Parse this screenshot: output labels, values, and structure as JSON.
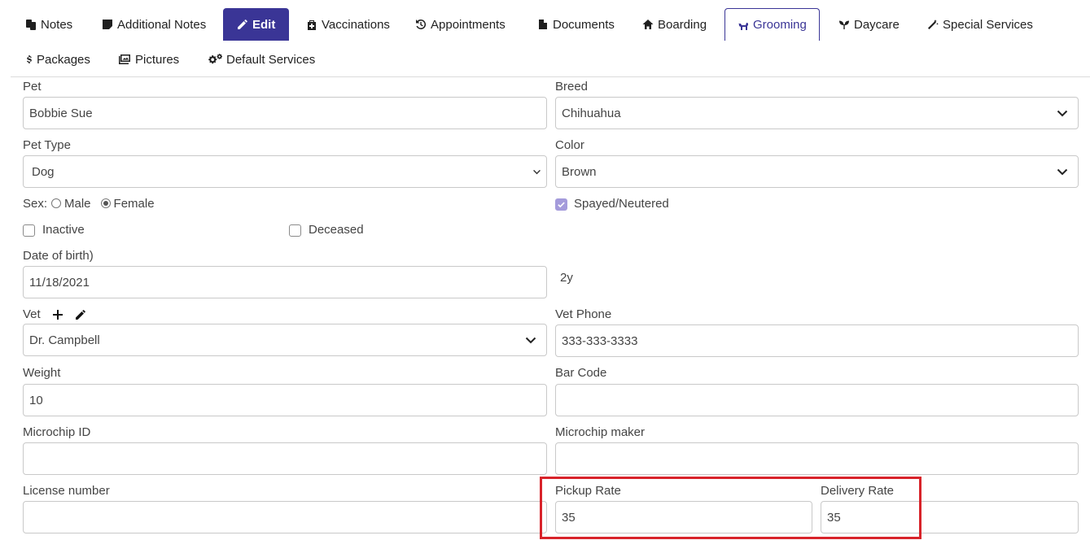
{
  "tabs": {
    "row1": [
      {
        "label": "Notes",
        "icon": "notes-icon"
      },
      {
        "label": "Additional Notes",
        "icon": "sticky-note-icon"
      },
      {
        "label": "Edit",
        "icon": "pencil-icon"
      },
      {
        "label": "Vaccinations",
        "icon": "medical-kit-icon"
      },
      {
        "label": "Appointments",
        "icon": "history-icon"
      },
      {
        "label": "Documents",
        "icon": "file-icon"
      },
      {
        "label": "Boarding",
        "icon": "home-icon"
      },
      {
        "label": "Grooming",
        "icon": "dog-icon"
      },
      {
        "label": "Daycare",
        "icon": "seedling-icon"
      },
      {
        "label": "Special Services",
        "icon": "magic-wand-icon"
      }
    ],
    "row2": [
      {
        "label": "Packages",
        "icon": "dollar-icon"
      },
      {
        "label": "Pictures",
        "icon": "images-icon"
      },
      {
        "label": "Default Services",
        "icon": "gears-icon"
      }
    ]
  },
  "form": {
    "pet": {
      "label": "Pet",
      "value": "Bobbie Sue"
    },
    "breed": {
      "label": "Breed",
      "value": "Chihuahua"
    },
    "pet_type": {
      "label": "Pet Type",
      "value": "Dog"
    },
    "color": {
      "label": "Color",
      "value": "Brown"
    },
    "sex": {
      "label": "Sex:",
      "options": [
        "Male",
        "Female"
      ],
      "selected": "Female"
    },
    "spayed": {
      "label": "Spayed/Neutered",
      "checked": true
    },
    "inactive": {
      "label": "Inactive",
      "checked": false
    },
    "deceased": {
      "label": "Deceased",
      "checked": false
    },
    "dob": {
      "label": "Date of birth)",
      "value": "11/18/2021",
      "age": "2y"
    },
    "vet": {
      "label": "Vet",
      "value": "Dr. Campbell"
    },
    "vet_phone": {
      "label": "Vet Phone",
      "value": "333-333-3333"
    },
    "weight": {
      "label": "Weight",
      "value": "10"
    },
    "bar_code": {
      "label": "Bar Code",
      "value": ""
    },
    "microchip_id": {
      "label": "Microchip ID",
      "value": ""
    },
    "microchip_maker": {
      "label": "Microchip maker",
      "value": ""
    },
    "license_number": {
      "label": "License number",
      "value": ""
    },
    "pickup_rate": {
      "label": "Pickup Rate",
      "value": "35"
    },
    "delivery_rate": {
      "label": "Delivery Rate",
      "value": "35"
    }
  },
  "colors": {
    "accent": "#3a3596",
    "highlight": "#d8232a",
    "checkbox_checked": "#a49bdb"
  }
}
